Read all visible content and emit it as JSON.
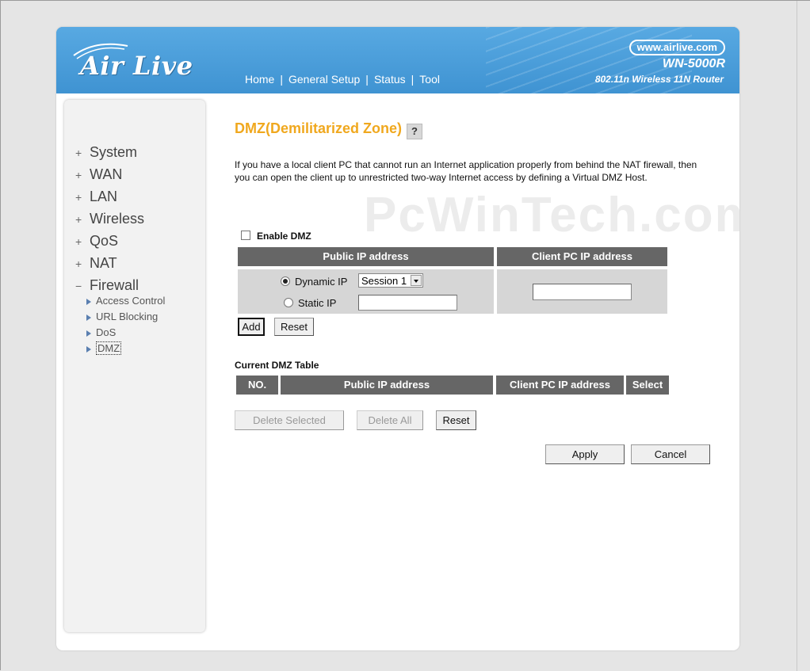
{
  "header": {
    "logo_text": "Air Live",
    "nav": [
      "Home",
      "General Setup",
      "Status",
      "Tool"
    ],
    "brand_url": "www.airlive.com",
    "model": "WN-5000R",
    "model_desc": "802.11n Wireless 11N Router"
  },
  "sidebar": {
    "items": [
      {
        "prefix": "+",
        "label": "System"
      },
      {
        "prefix": "+",
        "label": "WAN"
      },
      {
        "prefix": "+",
        "label": "LAN"
      },
      {
        "prefix": "+",
        "label": "Wireless"
      },
      {
        "prefix": "+",
        "label": "QoS"
      },
      {
        "prefix": "+",
        "label": "NAT"
      },
      {
        "prefix": "−",
        "label": "Firewall"
      }
    ],
    "subitems": [
      "Access Control",
      "URL Blocking",
      "DoS",
      "DMZ"
    ],
    "active_subitem": "DMZ"
  },
  "page": {
    "title": "DMZ(Demilitarized Zone)",
    "help_icon": "?",
    "description": "If you have a local client PC that cannot run an Internet application properly from behind the NAT firewall, then you can open the client up to unrestricted two-way Internet access by defining a Virtual DMZ Host.",
    "watermark": "PcWinTech.com"
  },
  "form": {
    "enable_label": "Enable DMZ",
    "enable_checked": false,
    "col_public": "Public IP address",
    "col_client": "Client PC IP address",
    "dynamic_label": "Dynamic IP",
    "dynamic_selected": true,
    "session_value": "Session 1",
    "static_label": "Static IP",
    "static_value": "",
    "client_value": "",
    "add_label": "Add",
    "reset_label": "Reset"
  },
  "table": {
    "title": "Current DMZ Table",
    "headers": [
      "NO.",
      "Public IP address",
      "Client PC IP address",
      "Select"
    ],
    "rows": [],
    "delete_selected_label": "Delete Selected",
    "delete_all_label": "Delete All",
    "reset_label": "Reset"
  },
  "footer_buttons": {
    "apply": "Apply",
    "cancel": "Cancel"
  },
  "colors": {
    "header_blue": "#479ad6",
    "title_orange": "#f0a81e",
    "table_header": "#666666",
    "table_cell": "#d6d6d6"
  }
}
